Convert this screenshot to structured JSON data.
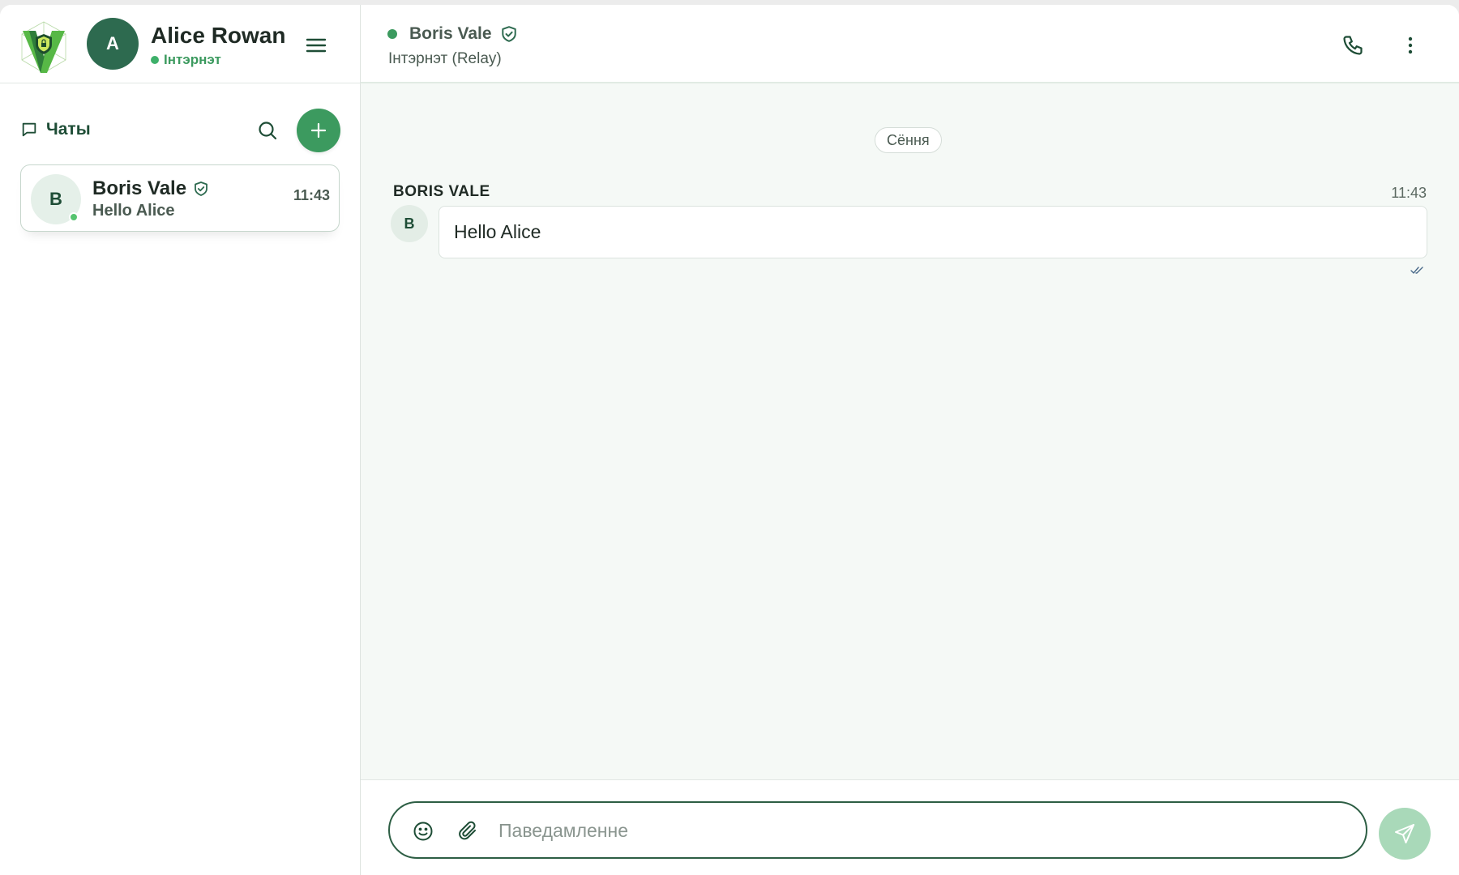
{
  "user": {
    "avatar_letter": "A",
    "name": "Alice Rowan",
    "status": "Інтэрнэт"
  },
  "sidebar": {
    "section_title": "Чаты",
    "icons": {
      "logo": "app-logo",
      "menu": "hamburger-icon",
      "chats": "chat-bubble-icon",
      "search": "search-icon",
      "new_chat": "plus-icon"
    },
    "chats": [
      {
        "avatar_letter": "B",
        "name": "Boris Vale",
        "preview": "Hello Alice",
        "time": "11:43",
        "online": true,
        "verified": true
      }
    ]
  },
  "conversation": {
    "peer_name": "Boris Vale",
    "peer_status": "Інтэрнэт (Relay)",
    "verified": true,
    "icons": {
      "call": "phone-icon",
      "more": "more-vertical-icon"
    },
    "date_divider": "Сёння",
    "messages": [
      {
        "sender": "BORIS VALE",
        "avatar_letter": "B",
        "time": "11:43",
        "text": "Hello Alice",
        "status": "read"
      }
    ]
  },
  "composer": {
    "placeholder": "Паведамленне",
    "value": "",
    "icons": {
      "emoji": "emoji-icon",
      "attach": "paperclip-icon",
      "send": "send-icon"
    }
  },
  "colors": {
    "brand": "#3c9a5f",
    "brand_dark": "#2d6a4f",
    "online": "#55c46f",
    "send_disabled": "#a9d9b9",
    "background": "#f5f9f6"
  }
}
